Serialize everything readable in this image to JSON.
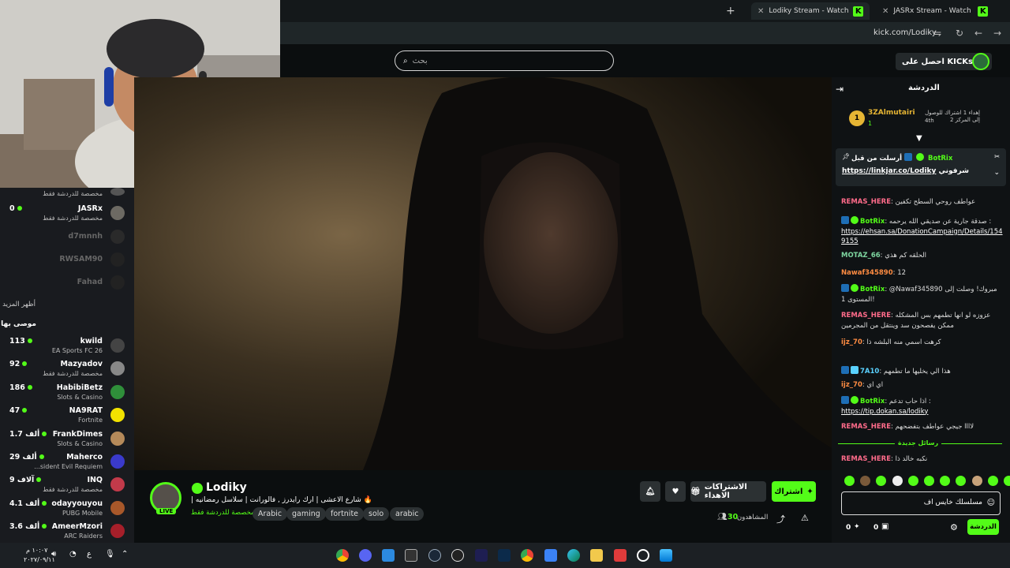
{
  "browser": {
    "tabs": [
      {
        "title": "Lodiky Stream - Watch Live on",
        "active": true
      },
      {
        "title": "JASRx Stream - Watch Live on",
        "active": false
      }
    ],
    "new_tab": "+",
    "url": "kick.com/Lodiky"
  },
  "header": {
    "search_placeholder": "بحث",
    "get_kicks": "احصل على KICKs"
  },
  "sidebar": {
    "channels": [
      {
        "name": "",
        "sub": "مخصصة للدردشة فقط",
        "count": "",
        "live": false
      },
      {
        "name": "JASRx",
        "sub": "مخصصة للدردشة فقط",
        "count": "0",
        "live": true
      },
      {
        "name": "d7mnnh",
        "sub": "",
        "count": "",
        "live": false
      },
      {
        "name": "RWSAM90",
        "sub": "",
        "count": "",
        "live": false
      },
      {
        "name": "Fahad",
        "sub": "",
        "count": "",
        "live": false
      }
    ],
    "show_more": "أظهر المزيد",
    "recommended_title": "موصى بها",
    "recommended": [
      {
        "name": "kwild",
        "sub": "EA Sports FC 26",
        "count": "113"
      },
      {
        "name": "Mazyadov",
        "sub": "مخصصة للدردشة فقط",
        "count": "92"
      },
      {
        "name": "HabibiBetz",
        "sub": "Slots & Casino",
        "count": "186"
      },
      {
        "name": "NA9RAT",
        "sub": "Fortnite",
        "count": "47"
      },
      {
        "name": "FrankDimes",
        "sub": "Slots & Casino",
        "count": "1.7 ألف"
      },
      {
        "name": "Maherco",
        "sub": "...sident Evil Requiem",
        "count": "29 ألف"
      },
      {
        "name": "INQ",
        "sub": "مخصصة للدردشة فقط",
        "count": "9 آلاف"
      },
      {
        "name": "odayyouyou",
        "sub": "PUBG Mobile",
        "count": "4.1 ألف"
      },
      {
        "name": "AmeerMzori",
        "sub": "ARC Raiders",
        "count": "3.6 ألف"
      }
    ]
  },
  "stream": {
    "streamer": "Lodiky",
    "live_badge": "LIVE",
    "title": "🔥 شارع الاعشى | ارك رايدرز , فالورانت | سلاسل رمضانيه |",
    "category": "مخصصة للدردشة فقط",
    "tags": [
      "Arabic",
      "gaming",
      "fortnite",
      "solo",
      "arabic"
    ],
    "follow_label": "اشتراك",
    "gift_subs_label": "الاشتراكات الاهداء",
    "viewers_label": "المشاهدون",
    "viewers_count": "30"
  },
  "chat": {
    "title": "الدردشة",
    "leader": {
      "name": "3ZAlmutairi",
      "rank": "1",
      "count": "1",
      "gift_text": "إهداء 1 اشتراك للوصول إلى المركز 2",
      "gift_extra": "4th"
    },
    "pinned": {
      "sender": "BotRix",
      "prefix": "أرسلت من قبل",
      "link": "https://linkjar.co/Lodiky",
      "suffix": "شرفوني"
    },
    "messages": [
      {
        "user": "REMAS_HERE",
        "color": "#ff6b8a",
        "text": "عواطف روحي السطح تكفين",
        "link": ""
      },
      {
        "user": "BotRix",
        "color": "#53fc18",
        "text": "صدقة جارية عن صديقي الله يرحمه :",
        "link": "https://ehsan.sa/DonationCampaign/Details/1549155"
      },
      {
        "user": "MOTAZ_66",
        "color": "#7ed6a0",
        "text": "الحلقه كم هذي",
        "link": ""
      },
      {
        "user": "Nawaf345890",
        "color": "#ff8c42",
        "text": "12",
        "link": ""
      },
      {
        "user": "BotRix",
        "color": "#53fc18",
        "text": "@Nawaf345890 مبروك! وصلت إلى المستوى 1!",
        "link": ""
      },
      {
        "user": "REMAS_HERE",
        "color": "#ff6b8a",
        "text": "عزوزه لو انها تطمهم بس المشكله ممكن يفصحون سد وينتقل من المجرمين",
        "link": ""
      },
      {
        "user": "ijz_70",
        "color": "#ff8c42",
        "text": "كرهت اسمي منه البلشه ذا",
        "link": ""
      },
      {
        "user": "7A10",
        "color": "#5ad1ff",
        "text": "هذا الي يخليها ما تطمهم",
        "link": ""
      },
      {
        "user": "ijz_70",
        "color": "#ff8c42",
        "text": "اي اي",
        "link": ""
      },
      {
        "user": "BotRix",
        "color": "#53fc18",
        "text": "اذا حاب تدعم :",
        "link": "https://tip.dokan.sa/lodiky"
      },
      {
        "user": "REMAS_HERE",
        "color": "#ff6b8a",
        "text": "لاااا جيجي عواطف بتفضحهم",
        "link": ""
      }
    ],
    "new_messages": "رسائل جديدة",
    "last_message": {
      "user": "REMAS_HERE",
      "color": "#ff6b8a",
      "text": "نكبه خالد ذا"
    },
    "input_value": "مسلسلك خايس اف",
    "send_label": "الدردشة",
    "points": "0",
    "gifts_count": "0"
  },
  "taskbar": {
    "time": "١٠:٠٧ م",
    "date": "٢٠٢٧/٠٩/١١",
    "lang": "ع"
  }
}
